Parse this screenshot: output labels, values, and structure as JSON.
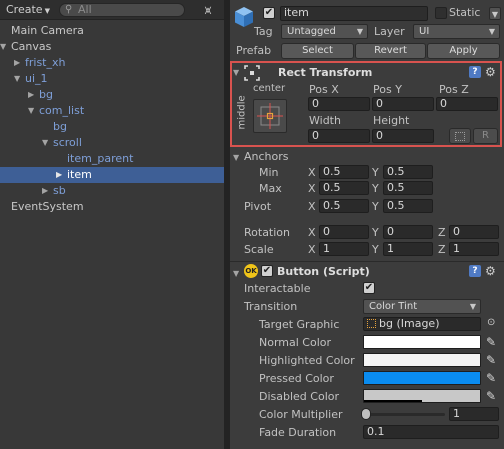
{
  "hierarchy": {
    "create_label": "Create",
    "search_placeholder": "All",
    "items": [
      {
        "label": "Main Camera",
        "depth": 0,
        "tri": "",
        "blue": false,
        "selected": false
      },
      {
        "label": "Canvas",
        "depth": 0,
        "tri": "▼",
        "blue": false,
        "selected": false
      },
      {
        "label": "frist_xh",
        "depth": 1,
        "tri": "▶",
        "blue": true,
        "selected": false
      },
      {
        "label": "ui_1",
        "depth": 1,
        "tri": "▼",
        "blue": true,
        "selected": false
      },
      {
        "label": "bg",
        "depth": 2,
        "tri": "▶",
        "blue": true,
        "selected": false
      },
      {
        "label": "com_list",
        "depth": 2,
        "tri": "▼",
        "blue": true,
        "selected": false
      },
      {
        "label": "bg",
        "depth": 3,
        "tri": "",
        "blue": true,
        "selected": false
      },
      {
        "label": "scroll",
        "depth": 3,
        "tri": "▼",
        "blue": true,
        "selected": false
      },
      {
        "label": "item_parent",
        "depth": 4,
        "tri": "",
        "blue": true,
        "selected": false
      },
      {
        "label": "item",
        "depth": 4,
        "tri": "▶",
        "blue": true,
        "selected": true
      },
      {
        "label": "sb",
        "depth": 3,
        "tri": "▶",
        "blue": true,
        "selected": false
      },
      {
        "label": "EventSystem",
        "depth": 0,
        "tri": "",
        "blue": false,
        "selected": false
      }
    ]
  },
  "inspector": {
    "object": {
      "active": true,
      "name": "item",
      "static_label": "Static",
      "static_checked": false,
      "tag_label": "Tag",
      "tag_value": "Untagged",
      "layer_label": "Layer",
      "layer_value": "UI",
      "prefab_label": "Prefab",
      "prefab_select": "Select",
      "prefab_revert": "Revert",
      "prefab_apply": "Apply"
    },
    "rect_transform": {
      "title": "Rect Transform",
      "anchor_h": "center",
      "anchor_v": "middle",
      "pos_x_label": "Pos X",
      "pos_y_label": "Pos Y",
      "pos_z_label": "Pos Z",
      "pos_x": "0",
      "pos_y": "0",
      "pos_z": "0",
      "width_label": "Width",
      "height_label": "Height",
      "width": "0",
      "height": "0",
      "raw_button": "R",
      "anchors_label": "Anchors",
      "min_label": "Min",
      "max_label": "Max",
      "anchor_min_x": "0.5",
      "anchor_min_y": "0.5",
      "anchor_max_x": "0.5",
      "anchor_max_y": "0.5",
      "pivot_label": "Pivot",
      "pivot_x": "0.5",
      "pivot_y": "0.5",
      "rotation_label": "Rotation",
      "rot_x": "0",
      "rot_y": "0",
      "rot_z": "0",
      "scale_label": "Scale",
      "scale_x": "1",
      "scale_y": "1",
      "scale_z": "1",
      "x": "X",
      "y": "Y",
      "z": "Z"
    },
    "button": {
      "badge": "OK",
      "enabled": true,
      "title": "Button (Script)",
      "interactable_label": "Interactable",
      "interactable": true,
      "transition_label": "Transition",
      "transition_value": "Color Tint",
      "target_graphic_label": "Target Graphic",
      "target_graphic_value": "bg (Image)",
      "normal_color_label": "Normal Color",
      "normal_color": "#ffffff",
      "highlighted_color_label": "Highlighted Color",
      "highlighted_color": "#f5f5f5",
      "pressed_color_label": "Pressed Color",
      "pressed_color": "#0a8cf0",
      "disabled_color_label": "Disabled Color",
      "disabled_color": "#c8c8c8",
      "color_multiplier_label": "Color Multiplier",
      "color_multiplier": "1",
      "fade_duration_label": "Fade Duration",
      "fade_duration": "0.1"
    },
    "colors": {
      "highlight_border": "#d9534f",
      "selection": "#3e5f96",
      "gameobject_icon": "#5aa0e6"
    }
  }
}
